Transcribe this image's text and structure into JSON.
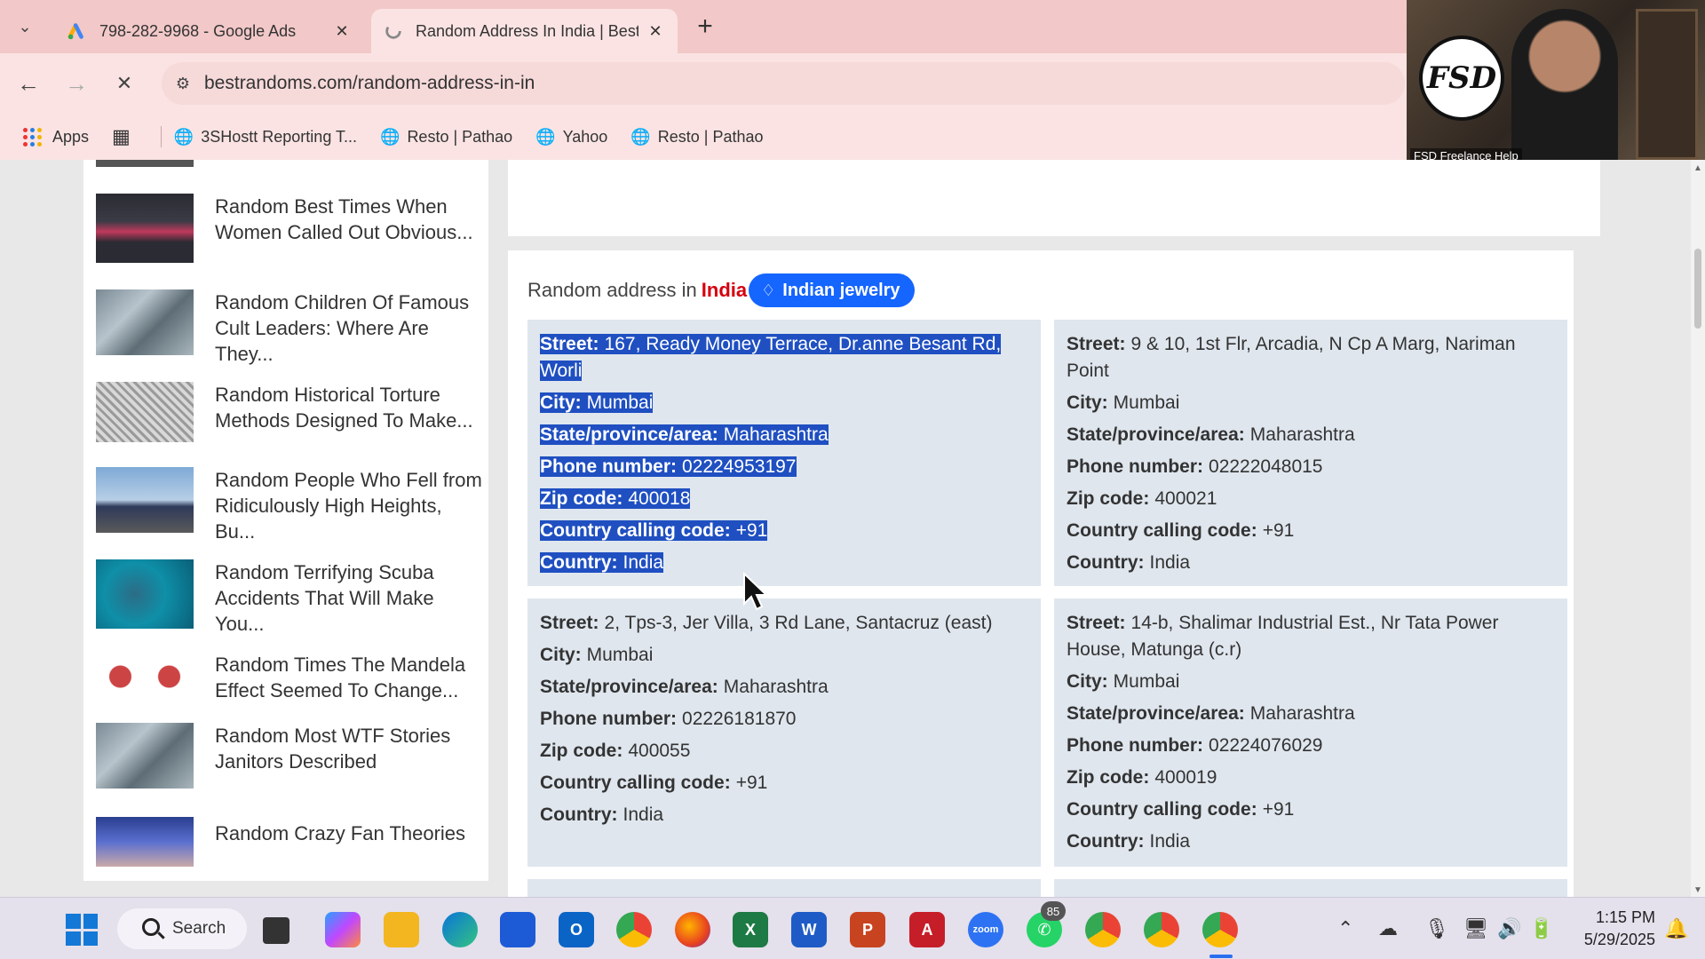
{
  "browser": {
    "tabs": [
      {
        "title": "798-282-9968 - Google Ads",
        "active": false
      },
      {
        "title": "Random Address In India | Best",
        "active": true
      }
    ],
    "url": "bestrandoms.com/random-address-in-in",
    "bookmarks": {
      "apps_label": "Apps",
      "items": [
        "3SHostt Reporting T...",
        "Resto | Pathao",
        "Yahoo",
        "Resto | Pathao"
      ]
    }
  },
  "webcam": {
    "logo": "FSD",
    "caption": "FSD Freelance Help"
  },
  "sidebar": {
    "items": [
      {
        "title": "Random Best Times When Women Called Out Obvious..."
      },
      {
        "title": "Random Children Of Famous Cult Leaders: Where Are They..."
      },
      {
        "title": "Random Historical Torture Methods Designed To Make..."
      },
      {
        "title": "Random People Who Fell from Ridiculously High Heights, Bu..."
      },
      {
        "title": "Random Terrifying Scuba Accidents That Will Make You..."
      },
      {
        "title": "Random Times The Mandela Effect Seemed To Change..."
      },
      {
        "title": "Random Most WTF Stories Janitors Described"
      },
      {
        "title": "Random Crazy Fan Theories"
      }
    ]
  },
  "main": {
    "heading_prefix": "Random address in",
    "heading_country": "India",
    "tag_label": "Indian jewelry",
    "labels": {
      "street": "Street:",
      "city": "City:",
      "state": "State/province/area:",
      "phone": "Phone number:",
      "zip": "Zip code:",
      "calling": "Country calling code:",
      "country": "Country:"
    },
    "addresses": [
      {
        "street": "167, Ready Money Terrace, Dr.anne Besant Rd, Worli",
        "city": "Mumbai",
        "state": "Maharashtra",
        "phone": "02224953197",
        "zip": "400018",
        "calling": "+91",
        "country": "India",
        "selected": true
      },
      {
        "street": "9 & 10, 1st Flr, Arcadia, N Cp A Marg, Nariman Point",
        "city": "Mumbai",
        "state": "Maharashtra",
        "phone": "02222048015",
        "zip": "400021",
        "calling": "+91",
        "country": "India",
        "selected": false
      },
      {
        "street": "2, Tps-3, Jer Villa, 3 Rd Lane, Santacruz (east)",
        "city": "Mumbai",
        "state": "Maharashtra",
        "phone": "02226181870",
        "zip": "400055",
        "calling": "+91",
        "country": "India",
        "selected": false
      },
      {
        "street": "14-b, Shalimar Industrial Est., Nr Tata Power House, Matunga (c.r)",
        "city": "Mumbai",
        "state": "Maharashtra",
        "phone": "02224076029",
        "zip": "400019",
        "calling": "+91",
        "country": "India",
        "selected": false
      }
    ]
  },
  "taskbar": {
    "search_label": "Search",
    "notification_badge": "85",
    "time": "1:15 PM",
    "date": "5/29/2025"
  }
}
